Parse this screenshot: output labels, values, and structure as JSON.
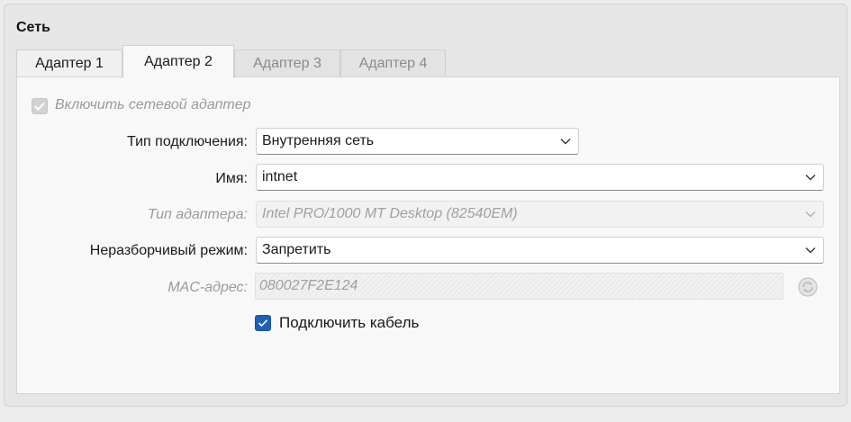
{
  "section": {
    "title": "Сеть"
  },
  "tabs": [
    {
      "label": "Адаптер 1",
      "state": "enabled"
    },
    {
      "label": "Адаптер 2",
      "state": "selected"
    },
    {
      "label": "Адаптер 3",
      "state": "disabled"
    },
    {
      "label": "Адаптер 4",
      "state": "disabled"
    }
  ],
  "adapter": {
    "enable_label": "Включить сетевой адаптер",
    "enable_checked": true,
    "enable_disabled": true,
    "attachment": {
      "label": "Тип подключения:",
      "value": "Внутренняя сеть"
    },
    "name": {
      "label": "Имя:",
      "value": "intnet"
    },
    "adapter_type": {
      "label": "Тип адаптера:",
      "value": "Intel PRO/1000 MT Desktop (82540EM)",
      "disabled": true
    },
    "promiscuous": {
      "label": "Неразборчивый режим:",
      "value": "Запретить"
    },
    "mac": {
      "label": "MAC-адрес:",
      "value": "080027F2E124",
      "disabled": true
    },
    "cable": {
      "label": "Подключить кабель",
      "checked": true
    }
  },
  "colors": {
    "accent": "#1f5fb4",
    "disabled_text": "#9a9a9a"
  },
  "icons": {
    "chevron": "chevron-down-icon",
    "refresh": "refresh-mac-icon",
    "check": "checkmark-icon"
  }
}
